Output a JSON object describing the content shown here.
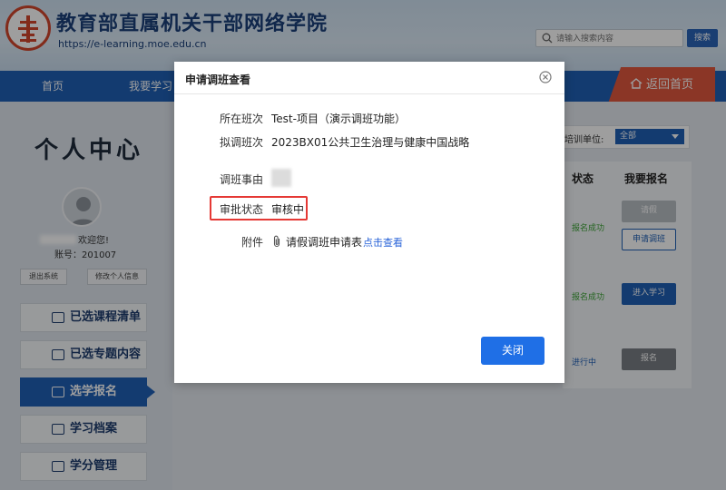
{
  "header": {
    "site_title": "教育部直属机关干部网络学院",
    "site_url": "https://e-learning.moe.edu.cn",
    "search_placeholder": "请输入搜索内容",
    "search_button": "搜索"
  },
  "nav": {
    "items": [
      "首页",
      "我要学习"
    ],
    "home_button": "返回首页"
  },
  "sidebar": {
    "title": "个人中心",
    "welcome_suffix": "欢迎您!",
    "account": "账号：201007",
    "logout": "退出系统",
    "edit_profile": "修改个人信息",
    "menu": [
      {
        "label": "已选课程清单"
      },
      {
        "label": "已选专题内容"
      },
      {
        "label": "选学报名",
        "active": true
      },
      {
        "label": "学习档案"
      },
      {
        "label": "学分管理"
      }
    ]
  },
  "content": {
    "filter_label": "培训单位:",
    "filter_value": "全部",
    "col_status": "状态",
    "col_signup": "我要报名",
    "rows": [
      {
        "status": "报名成功",
        "btn1": "请假",
        "btn2": "申请调班"
      },
      {
        "status": "报名成功",
        "btn1": "进入学习"
      },
      {
        "status": "进行中",
        "btn1": "报名"
      }
    ]
  },
  "modal": {
    "title": "申请调班查看",
    "fields": [
      {
        "label": "所在班次",
        "value": "Test-项目（演示调班功能）"
      },
      {
        "label": "拟调班次",
        "value": "2023BX01公共卫生治理与健康中国战略"
      },
      {
        "label": "调班事由",
        "value": ""
      },
      {
        "label": "审批状态",
        "value": "审核中"
      },
      {
        "label": "附件",
        "value": "请假调班申请表"
      }
    ],
    "attachment_link": "点击查看",
    "close_button": "关闭"
  },
  "colors": {
    "brand_blue": "#1f5fb5",
    "accent_red": "#e0573e",
    "highlight_red": "#e53935",
    "success_green": "#3aa335",
    "link_blue": "#2a64d8"
  }
}
